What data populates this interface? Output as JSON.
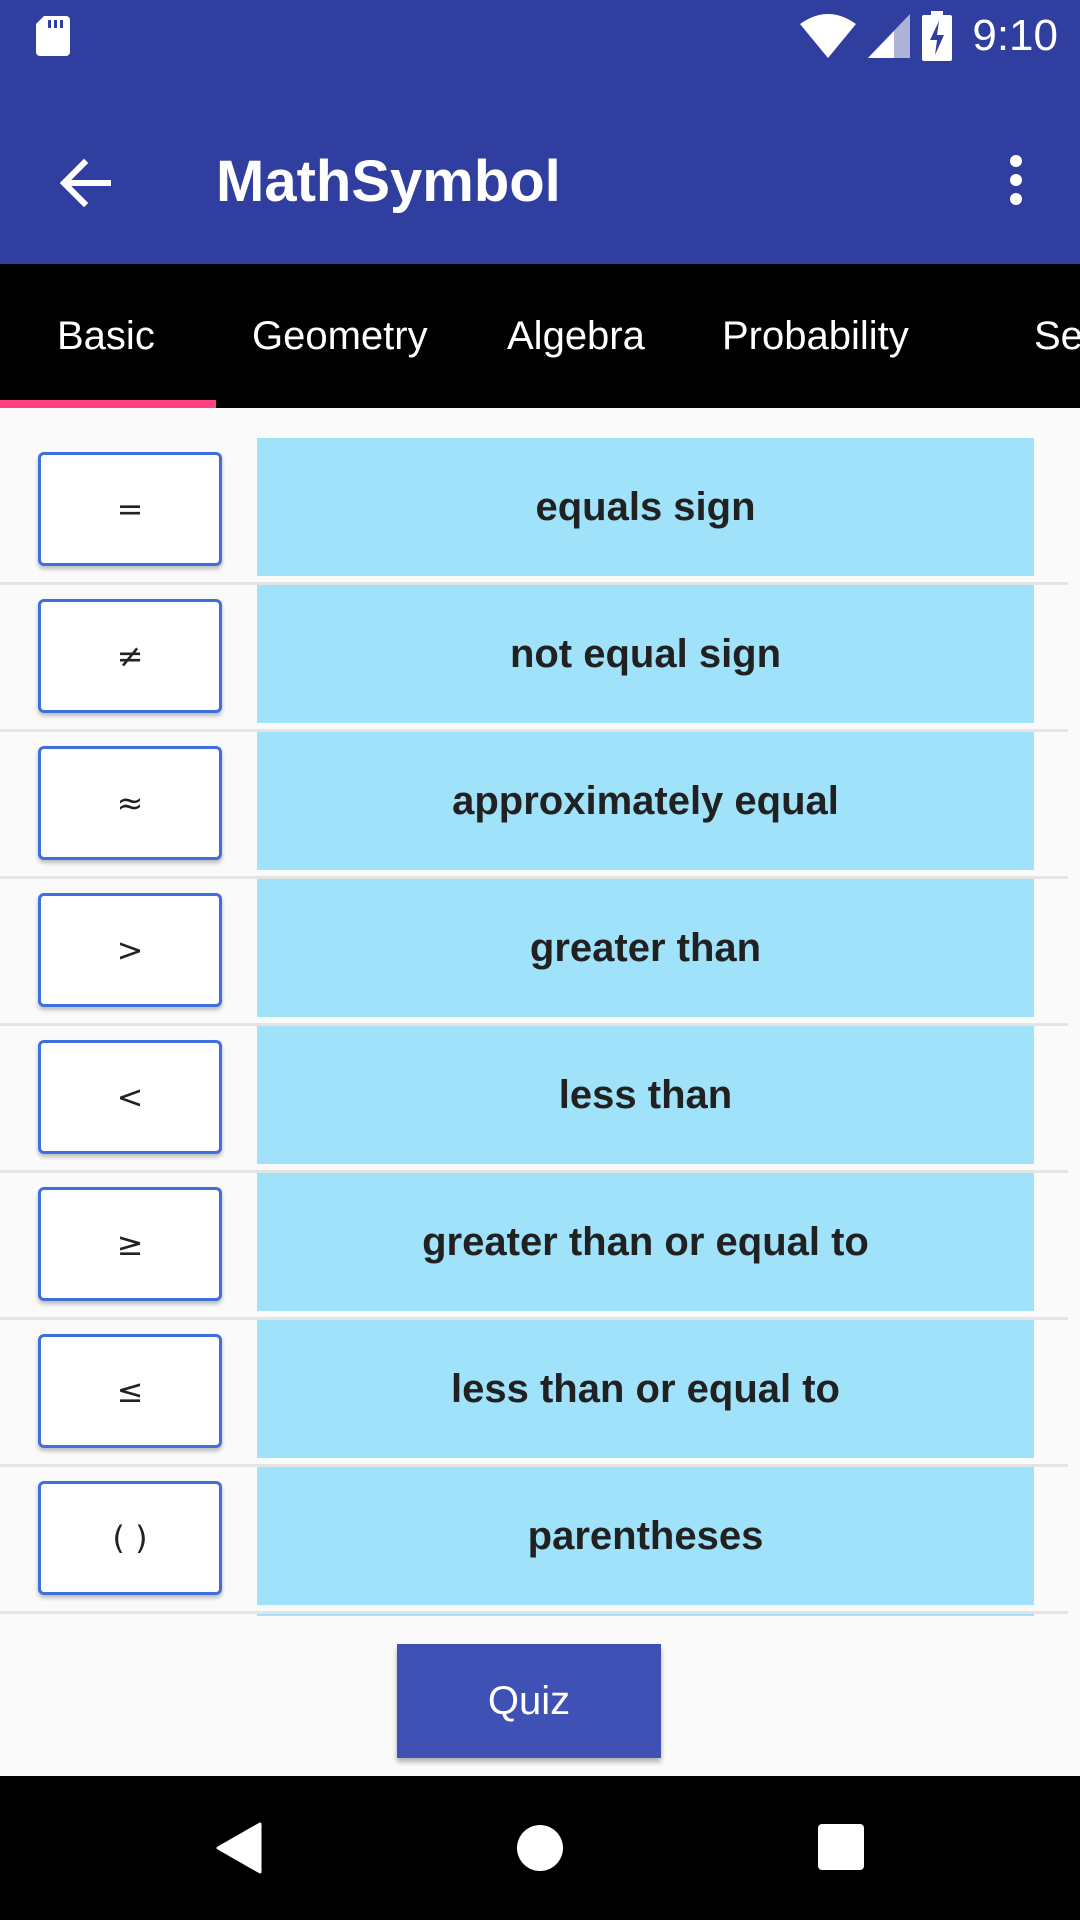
{
  "status_bar": {
    "time": "9:10",
    "icons": [
      "sd-card-icon",
      "wifi-icon",
      "signal-icon",
      "battery-charging-icon"
    ]
  },
  "app_bar": {
    "title": "MathSymbol",
    "back_icon": "arrow-back-icon",
    "menu_icon": "more-vert-icon"
  },
  "tabs": [
    {
      "label": "Basic",
      "selected": true
    },
    {
      "label": "Geometry",
      "selected": false
    },
    {
      "label": "Algebra",
      "selected": false
    },
    {
      "label": "Probability",
      "selected": false
    },
    {
      "label": "Se",
      "selected": false
    }
  ],
  "symbols": [
    {
      "symbol": "=",
      "name": "equals sign"
    },
    {
      "symbol": "≠",
      "name": "not equal sign"
    },
    {
      "symbol": "≈",
      "name": "approximately equal"
    },
    {
      "symbol": ">",
      "name": "greater than"
    },
    {
      "symbol": "<",
      "name": "less than"
    },
    {
      "symbol": "≥",
      "name": "greater than or equal to"
    },
    {
      "symbol": "≤",
      "name": "less than or equal to"
    },
    {
      "symbol": "( )",
      "name": "parentheses"
    }
  ],
  "quiz": {
    "label": "Quiz"
  },
  "colors": {
    "primary": "#303f9f",
    "accent": "#ff4081",
    "tab_background": "#000000",
    "symbol_border": "#3f6fdc",
    "name_background": "#a1e2fb",
    "quiz_button": "#3f51b5"
  }
}
